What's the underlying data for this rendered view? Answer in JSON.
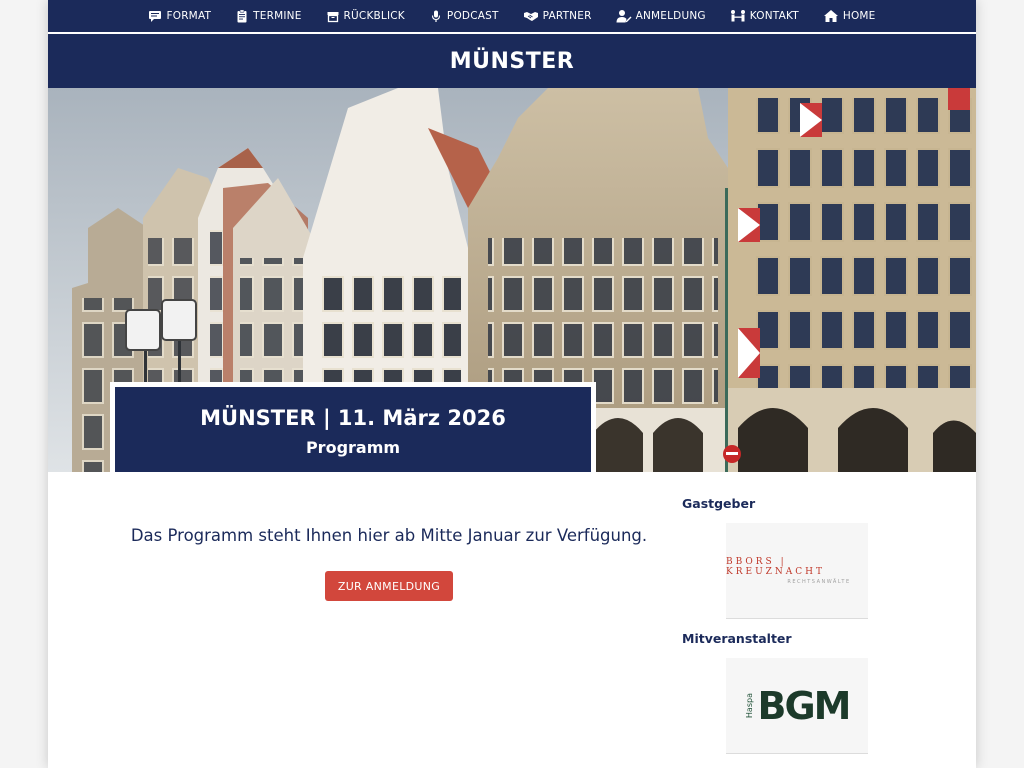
{
  "nav": {
    "items": [
      {
        "label": "FORMAT",
        "icon": "chat-bubble-icon"
      },
      {
        "label": "TERMINE",
        "icon": "clipboard-icon"
      },
      {
        "label": "RÜCKBLICK",
        "icon": "archive-box-icon"
      },
      {
        "label": "PODCAST",
        "icon": "microphone-icon"
      },
      {
        "label": "PARTNER",
        "icon": "handshake-icon"
      },
      {
        "label": "ANMELDUNG",
        "icon": "user-edit-icon"
      },
      {
        "label": "KONTAKT",
        "icon": "people-contact-icon"
      },
      {
        "label": "HOME",
        "icon": "home-icon"
      }
    ]
  },
  "page_title": "MÜNSTER",
  "hero": {
    "line1": "MÜNSTER | 11. März 2026",
    "line2": "Programm"
  },
  "main": {
    "notice": "Das Programm steht Ihnen hier ab Mitte Januar zur Verfügung.",
    "cta_label": "ZUR ANMELDUNG"
  },
  "sidebar": {
    "host_heading": "Gastgeber",
    "host_logo": {
      "main": "BBORS | KREUZNACHT",
      "sub": "RECHTSANWÄLTE"
    },
    "coorganizer_heading": "Mitveranstalter",
    "coorganizer_logo": {
      "small": "Haspa",
      "main": "BGM"
    }
  },
  "colors": {
    "navy": "#1b2a5a",
    "cta_red": "#d2473c",
    "white": "#ffffff"
  }
}
